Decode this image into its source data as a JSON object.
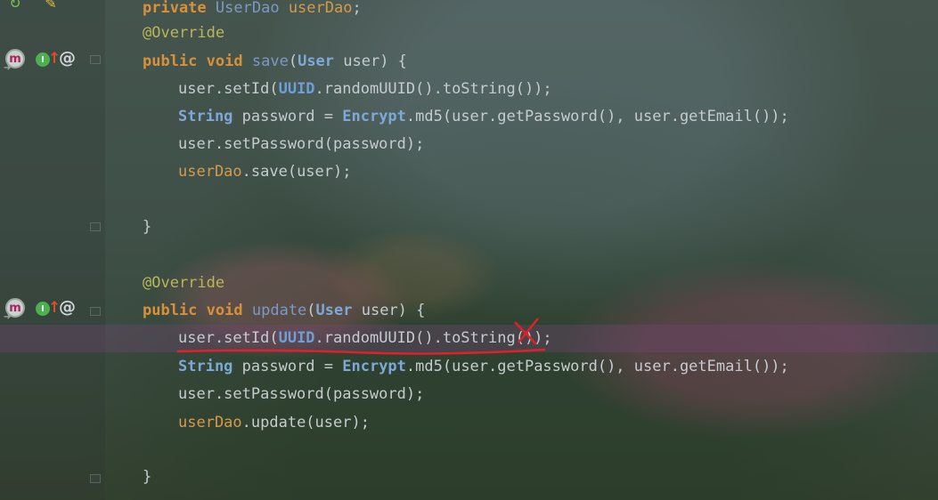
{
  "gutter": {
    "icons": [
      "implementing-method-icon",
      "implements-interface-icon",
      "override-at-icon"
    ]
  },
  "code": {
    "lines": [
      {
        "indent": 1,
        "tokens": [
          [
            "kw",
            "private"
          ],
          [
            "t",
            " "
          ],
          [
            "cls2",
            "UserDao"
          ],
          [
            "t",
            " "
          ],
          [
            "field",
            "userDao"
          ],
          [
            "t",
            ";"
          ]
        ]
      },
      {
        "indent": 1,
        "tokens": [
          [
            "ann",
            "@Override"
          ]
        ]
      },
      {
        "indent": 1,
        "tokens": [
          [
            "kw",
            "public"
          ],
          [
            "t",
            " "
          ],
          [
            "kw",
            "void"
          ],
          [
            "t",
            " "
          ],
          [
            "fn",
            "save"
          ],
          [
            "t",
            "("
          ],
          [
            "cls",
            "User"
          ],
          [
            "t",
            " user) {"
          ]
        ]
      },
      {
        "indent": 2,
        "tokens": [
          [
            "t",
            "user.setId("
          ],
          [
            "uuid",
            "UUID"
          ],
          [
            "t",
            ".randomUUID().toString());"
          ]
        ]
      },
      {
        "indent": 2,
        "tokens": [
          [
            "cls",
            "String"
          ],
          [
            "t",
            " password = "
          ],
          [
            "cls",
            "Encrypt"
          ],
          [
            "t",
            ".md5(user.getPassword(), user.getEmail());"
          ]
        ]
      },
      {
        "indent": 2,
        "tokens": [
          [
            "t",
            "user.setPassword(password);"
          ]
        ]
      },
      {
        "indent": 2,
        "tokens": [
          [
            "field",
            "userDao"
          ],
          [
            "t",
            ".save(user);"
          ]
        ]
      },
      {
        "indent": 1,
        "tokens": []
      },
      {
        "indent": 1,
        "tokens": [
          [
            "t",
            "}"
          ]
        ]
      },
      {
        "indent": 1,
        "tokens": []
      },
      {
        "indent": 1,
        "tokens": [
          [
            "ann",
            "@Override"
          ]
        ]
      },
      {
        "indent": 1,
        "tokens": [
          [
            "kw",
            "public"
          ],
          [
            "t",
            " "
          ],
          [
            "kw",
            "void"
          ],
          [
            "t",
            " "
          ],
          [
            "fn",
            "update"
          ],
          [
            "t",
            "("
          ],
          [
            "cls",
            "User"
          ],
          [
            "t",
            " user) {"
          ]
        ]
      },
      {
        "indent": 2,
        "tokens": [
          [
            "t",
            "user.setId("
          ],
          [
            "uuid",
            "UUID"
          ],
          [
            "t",
            ".randomUUID().toString());"
          ]
        ]
      },
      {
        "indent": 2,
        "tokens": [
          [
            "cls",
            "String"
          ],
          [
            "t",
            " password = "
          ],
          [
            "cls",
            "Encrypt"
          ],
          [
            "t",
            ".md5(user.getPassword(), user.getEmail());"
          ]
        ]
      },
      {
        "indent": 2,
        "tokens": [
          [
            "t",
            "user.setPassword(password);"
          ]
        ]
      },
      {
        "indent": 2,
        "tokens": [
          [
            "field",
            "userDao"
          ],
          [
            "t",
            ".update(user);"
          ]
        ]
      },
      {
        "indent": 1,
        "tokens": []
      },
      {
        "indent": 1,
        "tokens": [
          [
            "t",
            "}"
          ]
        ]
      }
    ]
  },
  "annotation": {
    "mark": "red-cross-mark",
    "underline_color": "#e0202a"
  },
  "colors": {
    "keyword": "#d8913a",
    "annotation": "#b9b659",
    "method": "#7d98c4",
    "field": "#d59a4a",
    "class": "#7ea8d6",
    "text": "#c6cbd0",
    "current_line": "#6e4670"
  }
}
